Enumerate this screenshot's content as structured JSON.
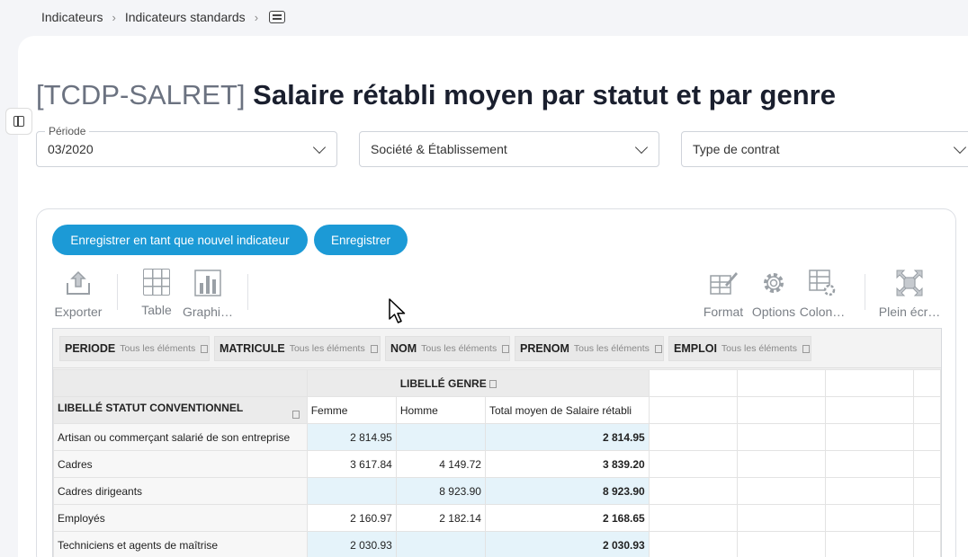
{
  "breadcrumb": {
    "items": [
      "Indicateurs",
      "Indicateurs standards"
    ],
    "icon": "details-icon"
  },
  "page": {
    "code": "[TCDP-SALRET]",
    "title": "Salaire rétabli moyen par statut et par genre"
  },
  "filters": {
    "period": {
      "label": "Période",
      "value": "03/2020"
    },
    "company": {
      "placeholder": "Société & Établissement"
    },
    "contract": {
      "placeholder": "Type de contrat"
    }
  },
  "actions": {
    "save_new": "Enregistrer en tant que nouvel indicateur",
    "save": "Enregistrer"
  },
  "toolbar": {
    "export": "Exporter",
    "table": "Table",
    "charts": "Graphi…",
    "format": "Format",
    "options": "Options",
    "columns": "Colon…",
    "fullscreen": "Plein écr…"
  },
  "pivot": {
    "all_items": "Tous les éléments",
    "fields": [
      "PERIODE",
      "MATRICULE",
      "NOM",
      "PRENOM",
      "EMPLOI"
    ],
    "column_field": "LIBELLÉ GENRE",
    "row_field": "LIBELLÉ STATUT CONVENTIONNEL",
    "columns": [
      "Femme",
      "Homme",
      "Total moyen de Salaire rétabli"
    ],
    "rows": [
      {
        "label": "Artisan ou commerçant salarié de son entreprise",
        "femme": "2 814.95",
        "homme": "",
        "total": "2 814.95"
      },
      {
        "label": "Cadres",
        "femme": "3 617.84",
        "homme": "4 149.72",
        "total": "3 839.20"
      },
      {
        "label": "Cadres dirigeants",
        "femme": "",
        "homme": "8 923.90",
        "total": "8 923.90"
      },
      {
        "label": "Employés",
        "femme": "2 160.97",
        "homme": "2 182.14",
        "total": "2 168.65"
      },
      {
        "label": "Techniciens et agents de maîtrise",
        "femme": "2 030.93",
        "homme": "",
        "total": "2 030.93"
      }
    ]
  },
  "colors": {
    "accent": "#1c9ad6",
    "highlight_cell": "#e5f3fa"
  }
}
